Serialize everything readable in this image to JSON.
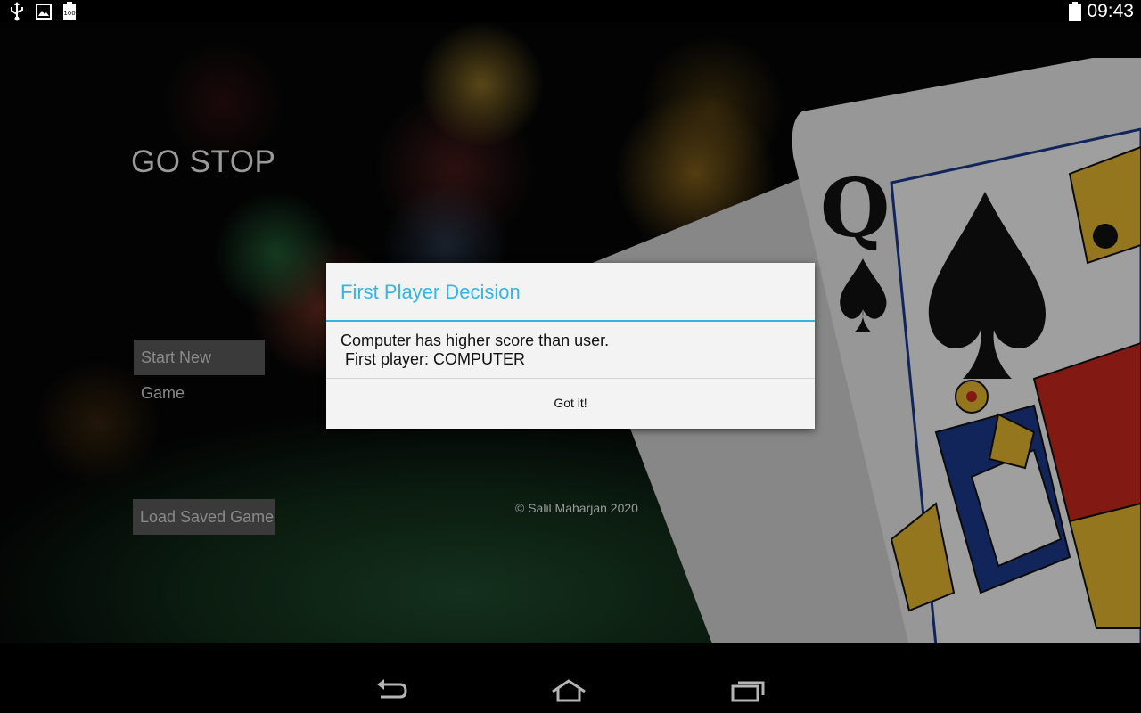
{
  "status_bar": {
    "icons": [
      "usb-icon",
      "image-icon",
      "battery-icon"
    ],
    "battery_level": "100",
    "clock": "09:43"
  },
  "app": {
    "title": "GO STOP",
    "start_button": "Start New Game",
    "load_button": "Load Saved Game",
    "copyright": "© Salil Maharjan 2020"
  },
  "dialog": {
    "title": "First Player Decision",
    "message": "Computer has higher score than user.\n First player: COMPUTER",
    "button": "Got it!"
  },
  "nav_bar": {
    "icons": [
      "back-icon",
      "home-icon",
      "recents-icon"
    ]
  },
  "colors": {
    "accent": "#35b5e5",
    "dialog_bg": "#f3f3f3"
  }
}
